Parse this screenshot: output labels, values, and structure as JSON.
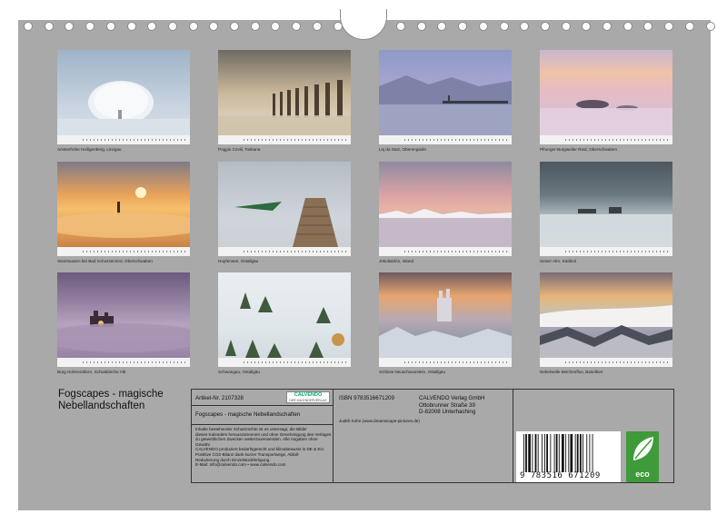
{
  "months": [
    {
      "caption": "Amsterhöhe Heiligenberg, Linzgau",
      "month_label": "Januar"
    },
    {
      "caption": "Poggio Covili, Toskana",
      "month_label": "Februar"
    },
    {
      "caption": "Lej da Staz, Oberengadin",
      "month_label": "März"
    },
    {
      "caption": "Pfrunger-Burgweiler Ried, Oberschwaben",
      "month_label": "April"
    },
    {
      "caption": "Steinhausen bei Bad Schussenried, Oberschwaben",
      "month_label": "Mai"
    },
    {
      "caption": "Hopfensee, Ostallgäu",
      "month_label": "Juni"
    },
    {
      "caption": "Jökulsárlón, Island",
      "month_label": "Juli"
    },
    {
      "caption": "Seiser Alm, Südtirol",
      "month_label": "August"
    },
    {
      "caption": "Burg Hohenzollern, Schwäbische Alb",
      "month_label": "September"
    },
    {
      "caption": "Schwangau, Ostallgäu",
      "month_label": "Oktober"
    },
    {
      "caption": "Schloss Neuschwanstein, Ostallgäu",
      "month_label": "November"
    },
    {
      "caption": "Nebelwelle Belchenflue, Baselbiet",
      "month_label": "Dezember"
    }
  ],
  "product": {
    "title": "Fogscapes - magische Nebellandschaften",
    "article_no": "Artikel-Nr. 2107328",
    "isbn": "ISBN 9783516671209",
    "subtitle": "Fogscapes - magische Nebellandschaften",
    "author": "Judith Kuhn (www.dreamscape-pictures.de)",
    "legal_lines": [
      "Inhalte bestehender Schutzrechte ist es untersagt, die Bilder",
      "dieses Kalenders herauszutrennen und ohne Genehmigung des Verlages",
      "zu gewerblichen Zwecken weiterzuverwenden. Alle Angaben ohne",
      "Gewähr.",
      "CALVENDO produziert bedarfsgerecht und klimabewusst in DE & EU.",
      "Postitive CO2-Bilanz dank kurzer Transportwege, Abfall-",
      "Reduzierung durch Einzelstückfertigung.",
      "E-Mail: info@calvendo.com • www.calvendo.com"
    ],
    "publisher_lines": [
      "CALVENDO Verlag GmbH",
      "Ottobrunner Straße 39",
      "D-82008 Unterhaching"
    ],
    "calvendo_logo": "CALVENDO",
    "calvendo_tag": "DER KALENDERVERLAG",
    "barcode_number": "9 783516 671209",
    "eco_label": "eco"
  },
  "colors": {
    "background": "#a9a9a9",
    "eco": "#3f9a3a"
  }
}
